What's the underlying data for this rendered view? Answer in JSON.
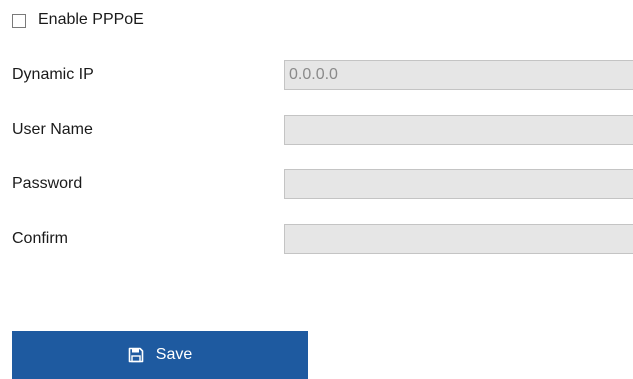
{
  "pppoe": {
    "checkbox_checked": false,
    "label": "Enable PPPoE"
  },
  "form": {
    "dynamic_ip": {
      "label": "Dynamic IP",
      "value": "0.0.0.0",
      "disabled": true
    },
    "user_name": {
      "label": "User Name",
      "value": "",
      "disabled": true
    },
    "password": {
      "label": "Password",
      "value": "",
      "disabled": true
    },
    "confirm": {
      "label": "Confirm",
      "value": "",
      "disabled": true
    }
  },
  "save_button": {
    "label": "Save",
    "icon": "save-icon"
  },
  "colors": {
    "button_bg": "#1e5aa0",
    "field_bg": "#e6e6e6",
    "field_border": "#c4c4c4",
    "field_text": "#8a8a8a"
  }
}
